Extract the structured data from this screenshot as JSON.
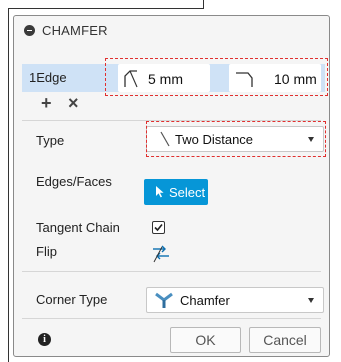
{
  "dialog": {
    "title": "CHAMFER"
  },
  "edges": {
    "count": "1",
    "label": "Edge",
    "distance1": "5 mm",
    "distance2": "10 mm",
    "add_label": "+",
    "remove_label": "×"
  },
  "type": {
    "label": "Type",
    "value": "Two Distance"
  },
  "edges_faces": {
    "label": "Edges/Faces",
    "button": "Select"
  },
  "tangent_chain": {
    "label": "Tangent Chain",
    "checked": true
  },
  "flip": {
    "label": "Flip"
  },
  "corner_type": {
    "label": "Corner Type",
    "value": "Chamfer"
  },
  "footer": {
    "info": "i",
    "ok": "OK",
    "cancel": "Cancel"
  },
  "colors": {
    "accent": "#0696d7",
    "highlight": "#cfe2f6",
    "annotation": "#e0302f"
  }
}
